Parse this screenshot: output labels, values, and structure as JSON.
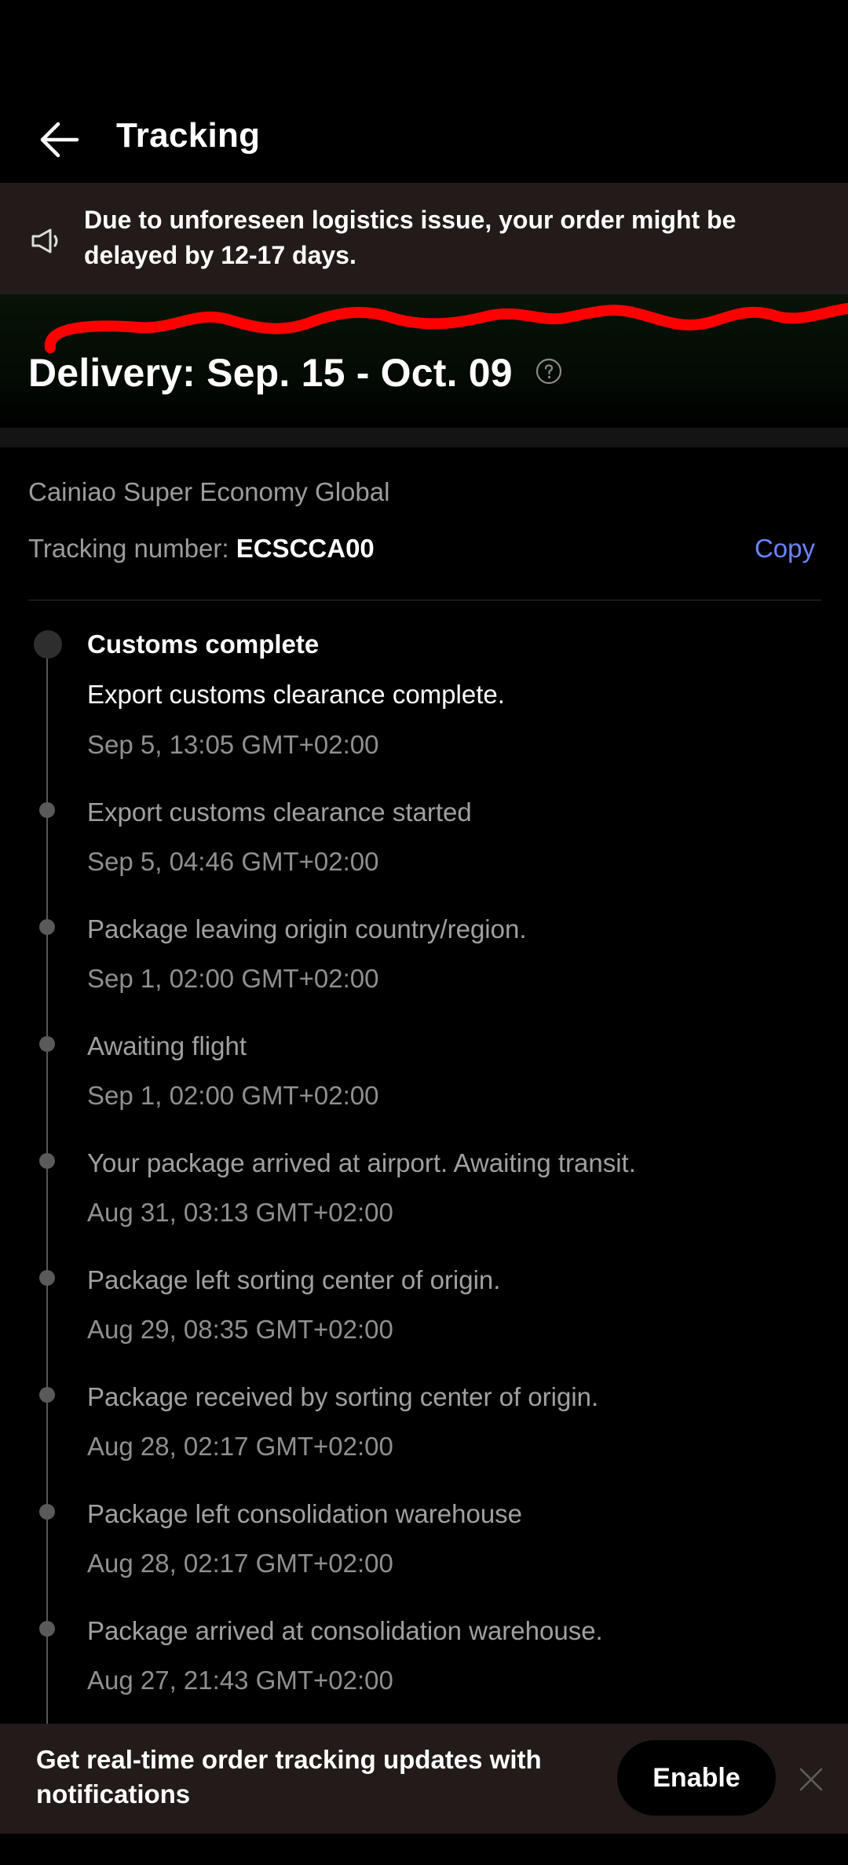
{
  "header": {
    "title": "Tracking"
  },
  "notice": {
    "text": "Due to unforeseen logistics issue, your order might be delayed by 12-17 days."
  },
  "delivery": {
    "title": "Delivery: Sep. 15 - Oct. 09"
  },
  "carrier": {
    "name": "Cainiao Super Economy Global",
    "tracking_label": "Tracking number: ",
    "tracking_number": "ECSCCA00",
    "copy_label": "Copy"
  },
  "events": [
    {
      "title": "Customs complete",
      "desc": "Export customs clearance complete.",
      "time": "Sep 5, 13:05 GMT+02:00"
    },
    {
      "title": "Export customs clearance started",
      "time": "Sep 5, 04:46 GMT+02:00"
    },
    {
      "title": "Package leaving origin country/region.",
      "time": "Sep 1, 02:00 GMT+02:00"
    },
    {
      "title": "Awaiting flight",
      "time": "Sep 1, 02:00 GMT+02:00"
    },
    {
      "title": "Your package arrived at airport. Awaiting transit.",
      "time": "Aug 31, 03:13 GMT+02:00"
    },
    {
      "title": "Package left sorting center of origin.",
      "time": "Aug 29, 08:35 GMT+02:00"
    },
    {
      "title": "Package received by sorting center of origin.",
      "time": "Aug 28, 02:17 GMT+02:00"
    },
    {
      "title": "Package left consolidation warehouse",
      "time": "Aug 28, 02:17 GMT+02:00"
    },
    {
      "title": "Package arrived at consolidation warehouse.",
      "time": "Aug 27, 21:43 GMT+02:00"
    }
  ],
  "banner": {
    "text": "Get real-time order tracking updates with notifications",
    "enable_label": "Enable"
  },
  "colors": {
    "accent_link": "#6b84ff",
    "banner_bg": "#231a1a",
    "annotation": "#ff0000"
  },
  "icons": {
    "back": "arrow-left-icon",
    "speaker": "speaker-icon",
    "help": "question-circle-icon",
    "close": "close-icon"
  }
}
